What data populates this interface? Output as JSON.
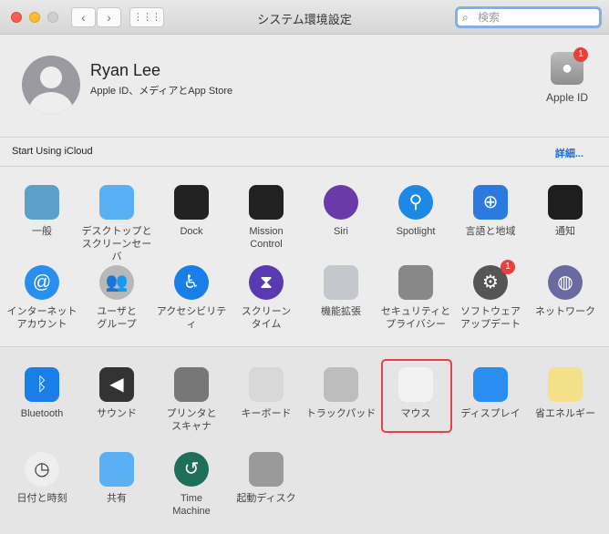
{
  "window": {
    "title": "システム環境設定",
    "search_placeholder": "検索"
  },
  "account": {
    "name": "Ryan Lee",
    "subtitle": "Apple ID、メディアとApp Store",
    "apple_id_label": "Apple ID",
    "apple_id_badge": "1"
  },
  "icloud": {
    "text": "Start Using iCloud",
    "details": "詳細..."
  },
  "panes": [
    {
      "label": "一般",
      "icon": "general-icon",
      "color": "#5aa0c8"
    },
    {
      "label": "デスクトップと\nスクリーンセーバ",
      "icon": "desktop-icon",
      "color": "#5ab0f5"
    },
    {
      "label": "Dock",
      "icon": "dock-icon",
      "color": "#222222"
    },
    {
      "label": "Mission\nControl",
      "icon": "mission-control-icon",
      "color": "#222222"
    },
    {
      "label": "Siri",
      "icon": "siri-icon",
      "color": "#6a3aa8"
    },
    {
      "label": "Spotlight",
      "icon": "spotlight-icon",
      "color": "#1e88e5"
    },
    {
      "label": "言語と地域",
      "icon": "language-flag-icon",
      "color": "#2a7ae0"
    },
    {
      "label": "通知",
      "icon": "notifications-icon",
      "color": "#1e1e1e"
    },
    {
      "label": "インターネット\nアカウント",
      "icon": "at-icon",
      "color": "#2a8ef0"
    },
    {
      "label": "ユーザと\nグループ",
      "icon": "users-icon",
      "color": "#b8b8b8"
    },
    {
      "label": "アクセシビリティ",
      "icon": "accessibility-icon",
      "color": "#1a7ee8"
    },
    {
      "label": "スクリーン\nタイム",
      "icon": "hourglass-icon",
      "color": "#5a3ab0"
    },
    {
      "label": "機能拡張",
      "icon": "puzzle-icon",
      "color": "#c4c8cc"
    },
    {
      "label": "セキュリティと\nプライバシー",
      "icon": "security-house-icon",
      "color": "#888888"
    },
    {
      "label": "ソフトウェア\nアップデート",
      "icon": "gear-icon",
      "color": "#555555",
      "badge": "1"
    },
    {
      "label": "ネットワーク",
      "icon": "globe-icon",
      "color": "#6a6aa0"
    },
    {
      "label": "Bluetooth",
      "icon": "bluetooth-icon",
      "color": "#1a7ee8"
    },
    {
      "label": "サウンド",
      "icon": "speaker-icon",
      "color": "#333333"
    },
    {
      "label": "プリンタと\nスキャナ",
      "icon": "printer-icon",
      "color": "#777777"
    },
    {
      "label": "キーボード",
      "icon": "keyboard-icon",
      "color": "#d8d8d8"
    },
    {
      "label": "トラックパッド",
      "icon": "trackpad-icon",
      "color": "#bdbdbd"
    },
    {
      "label": "マウス",
      "icon": "mouse-icon",
      "color": "#f2f2f2"
    },
    {
      "label": "ディスプレイ",
      "icon": "display-icon",
      "color": "#2a8ef0"
    },
    {
      "label": "省エネルギー",
      "icon": "lightbulb-icon",
      "color": "#f5e08a"
    },
    {
      "label": "日付と時刻",
      "icon": "clock-icon",
      "color": "#eeeeee"
    },
    {
      "label": "共有",
      "icon": "shared-folder-icon",
      "color": "#5ab0f5"
    },
    {
      "label": "Time\nMachine",
      "icon": "time-machine-icon",
      "color": "#1e6e5a"
    },
    {
      "label": "起動ディスク",
      "icon": "disk-icon",
      "color": "#9a9a9a"
    }
  ],
  "selected": "キーボード"
}
